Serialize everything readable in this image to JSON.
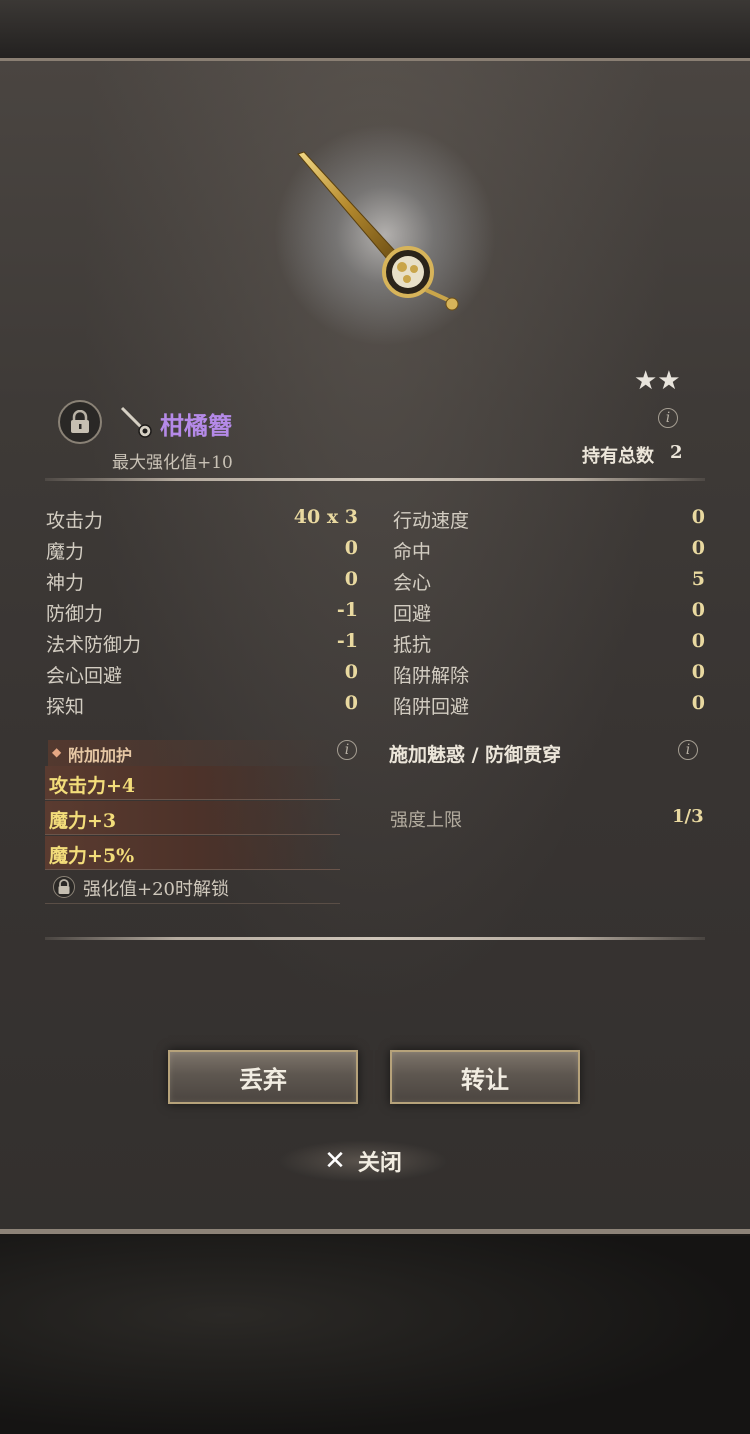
{
  "item": {
    "name": "柑橘簪",
    "max_enhance": "最大强化值+10",
    "stars": "★★",
    "owned_label": "持有总数",
    "owned_value": "2",
    "name_color": "#b58ae8"
  },
  "stats_left": [
    {
      "label": "攻击力",
      "value": "40 x 3"
    },
    {
      "label": "魔力",
      "value": "0"
    },
    {
      "label": "神力",
      "value": "0"
    },
    {
      "label": "防御力",
      "value": "-1"
    },
    {
      "label": "法术防御力",
      "value": "-1"
    },
    {
      "label": "会心回避",
      "value": "0"
    },
    {
      "label": "探知",
      "value": "0"
    }
  ],
  "stats_right": [
    {
      "label": "行动速度",
      "value": "0"
    },
    {
      "label": "命中",
      "value": "0"
    },
    {
      "label": "会心",
      "value": "5"
    },
    {
      "label": "回避",
      "value": "0"
    },
    {
      "label": "抵抗",
      "value": "0"
    },
    {
      "label": "陷阱解除",
      "value": "0"
    },
    {
      "label": "陷阱回避",
      "value": "0"
    }
  ],
  "enchant": {
    "title": "附加加护",
    "items": [
      "攻击力+4",
      "魔力+3",
      "魔力+5%"
    ],
    "locked_text": "强化值+20时解锁"
  },
  "charm": {
    "title": "施加魅惑 / 防御贯穿",
    "limit_label": "强度上限",
    "limit_value": "1/3"
  },
  "actions": {
    "discard": "丢弃",
    "transfer": "转让",
    "close": "关闭"
  },
  "icons": {
    "lock": "lock-icon",
    "info": "info-icon",
    "close": "close-icon",
    "hairpin": "hairpin-icon"
  }
}
